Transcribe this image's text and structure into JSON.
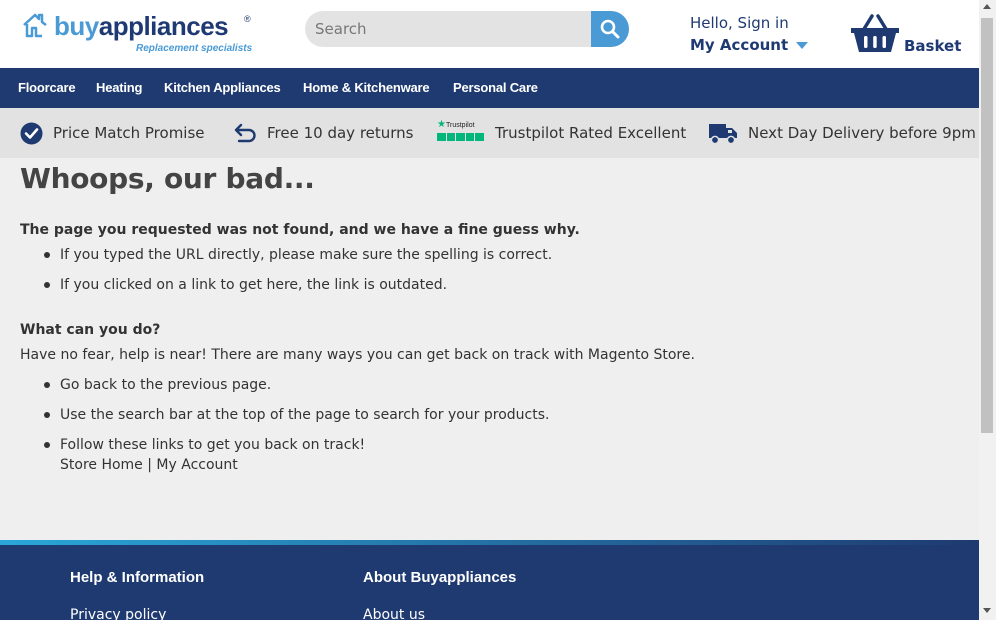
{
  "header": {
    "logo": {
      "part1": "buy",
      "part2": "appliances",
      "registered": "®",
      "tagline": "Replacement specialists"
    },
    "search": {
      "placeholder": "Search",
      "icon": "search-icon"
    },
    "account": {
      "greeting": "Hello, Sign in",
      "link": "My Account"
    },
    "basket": {
      "label": "Basket",
      "icon": "basket-icon"
    }
  },
  "nav": {
    "items": [
      "Floorcare",
      "Heating",
      "Kitchen Appliances",
      "Home & Kitchenware",
      "Personal Care"
    ]
  },
  "usp": {
    "items": [
      {
        "icon": "check-circle-icon",
        "text": "Price Match Promise"
      },
      {
        "icon": "return-arrow-icon",
        "text": "Free 10 day returns"
      },
      {
        "icon": "trustpilot-icon",
        "badge": "Trustpilot",
        "text": "Trustpilot Rated Excellent"
      },
      {
        "icon": "truck-icon",
        "text": "Next Day Delivery before 9pm"
      }
    ]
  },
  "main": {
    "title": "Whoops, our bad...",
    "intro": "The page you requested was not found, and we have a fine guess why.",
    "reasons": [
      "If you typed the URL directly, please make sure the spelling is correct.",
      "If you clicked on a link to get here, the link is outdated."
    ],
    "what_heading": "What can you do?",
    "what_text": "Have no fear, help is near! There are many ways you can get back on track with Magento Store.",
    "options": [
      "Go back to the previous page.",
      "Use the search bar at the top of the page to search for your products.",
      "Follow these links to get you back on track!"
    ],
    "links": {
      "store_home": "Store Home",
      "separator": "|",
      "my_account": "My Account"
    }
  },
  "footer": {
    "columns": [
      {
        "heading": "Help & Information",
        "first_link": "Privacy policy"
      },
      {
        "heading": "About Buyappliances",
        "first_link": "About us"
      }
    ]
  },
  "colors": {
    "navy": "#1e3a70",
    "blue": "#4a9ad6",
    "background": "#efefef",
    "trustpilot_green": "#00b67a"
  }
}
